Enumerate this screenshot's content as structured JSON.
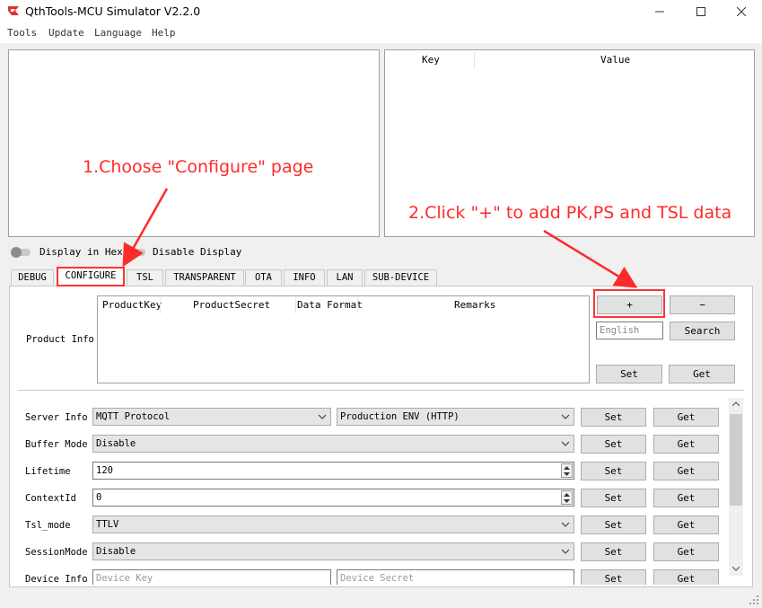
{
  "window": {
    "title": "QthTools-MCU Simulator V2.2.0",
    "controls": [
      "minimize-icon",
      "maximize-icon",
      "close-icon"
    ]
  },
  "menu": [
    "Tools",
    "Update",
    "Language",
    "Help"
  ],
  "kv_table": {
    "columns": [
      "Key",
      "Value"
    ]
  },
  "toggles": {
    "hex": "Display in Hex",
    "disable": "Disable Display"
  },
  "tabs": [
    "DEBUG",
    "CONFIGURE",
    "TSL",
    "TRANSPARENT",
    "OTA",
    "INFO",
    "LAN",
    "SUB-DEVICE"
  ],
  "active_tab": "CONFIGURE",
  "product_info": {
    "label": "Product Info",
    "columns": [
      "ProductKey",
      "ProductSecret",
      "Data Format",
      "Remarks"
    ],
    "add_label": "+",
    "remove_label": "−",
    "language_placeholder": "English",
    "search_label": "Search",
    "set_label": "Set",
    "get_label": "Get"
  },
  "settings": {
    "set_label": "Set",
    "get_label": "Get",
    "server_label": "Server Info",
    "server_protocol": "MQTT Protocol",
    "server_env": "Production ENV (HTTP)",
    "buffer_label": "Buffer Mode",
    "buffer_value": "Disable",
    "lifetime_label": "Lifetime",
    "lifetime_value": "120",
    "contextid_label": "ContextId",
    "contextid_value": "0",
    "tslmode_label": "Tsl_mode",
    "tslmode_value": "TTLV",
    "sessionmode_label": "SessionMode",
    "sessionmode_value": "Disable",
    "deviceinfo_label": "Device Info",
    "devicekey_placeholder": "Device Key",
    "devicesecret_placeholder": "Device Secret"
  },
  "annotations": {
    "step1": "1.Choose \"Configure\" page",
    "step2": "2.Click \"+\" to add PK,PS and TSL data"
  },
  "colors": {
    "annotation": "#ff2a2a",
    "window_bg": "#f0f0f0"
  }
}
